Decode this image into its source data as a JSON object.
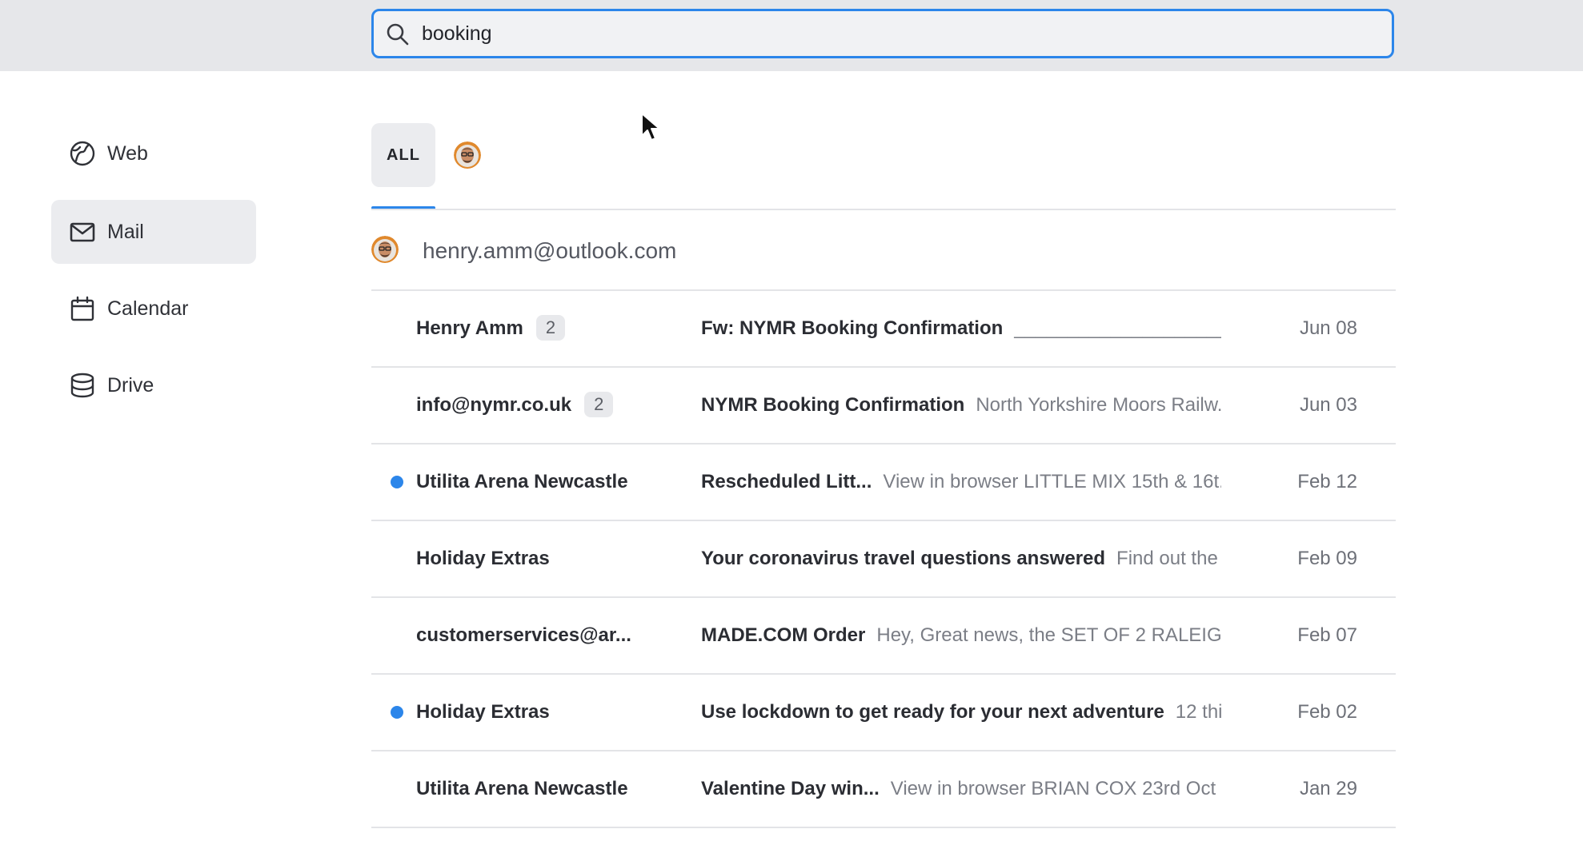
{
  "search": {
    "value": "booking"
  },
  "sidebar": {
    "items": [
      {
        "label": "Web",
        "icon": "globe-icon",
        "active": false
      },
      {
        "label": "Mail",
        "icon": "mail-icon",
        "active": true
      },
      {
        "label": "Calendar",
        "icon": "calendar-icon",
        "active": false
      },
      {
        "label": "Drive",
        "icon": "database-icon",
        "active": false
      }
    ]
  },
  "tabs": {
    "all_label": "ALL"
  },
  "account": {
    "email": "henry.amm@outlook.com"
  },
  "colors": {
    "accent": "#2c86ea",
    "unread_dot": "#2c86ea",
    "active_bg": "#ebecef"
  },
  "emails": [
    {
      "sender": "Henry Amm",
      "count": "2",
      "unread": false,
      "subject": "Fw: NYMR Booking Confirmation",
      "snippet": "________________________...",
      "date": "Jun 08"
    },
    {
      "sender": "info@nymr.co.uk",
      "count": "2",
      "unread": false,
      "subject": "NYMR Booking Confirmation",
      "snippet": "North Yorkshire Moors Railw...",
      "date": "Jun 03"
    },
    {
      "sender": "Utilita Arena Newcastle",
      "count": "",
      "unread": true,
      "subject": "Rescheduled Litt...",
      "snippet": "View in browser LITTLE MIX 15th & 16t...",
      "date": "Feb 12"
    },
    {
      "sender": "Holiday Extras",
      "count": "",
      "unread": false,
      "subject": "Your coronavirus travel questions answered",
      "snippet": "Find out the l...",
      "date": "Feb 09"
    },
    {
      "sender": "customerservices@ar...",
      "count": "",
      "unread": false,
      "subject": "MADE.COM Order",
      "snippet": "Hey, Great news, the SET OF 2 RALEIG...",
      "date": "Feb 07"
    },
    {
      "sender": "Holiday Extras",
      "count": "",
      "unread": true,
      "subject": "Use lockdown to get ready for your next adventure",
      "snippet": "12 thin...",
      "date": "Feb 02"
    },
    {
      "sender": "Utilita Arena Newcastle",
      "count": "",
      "unread": false,
      "subject": "Valentine Day win...",
      "snippet": "View in browser BRIAN COX 23rd Oct ...",
      "date": "Jan 29"
    }
  ]
}
